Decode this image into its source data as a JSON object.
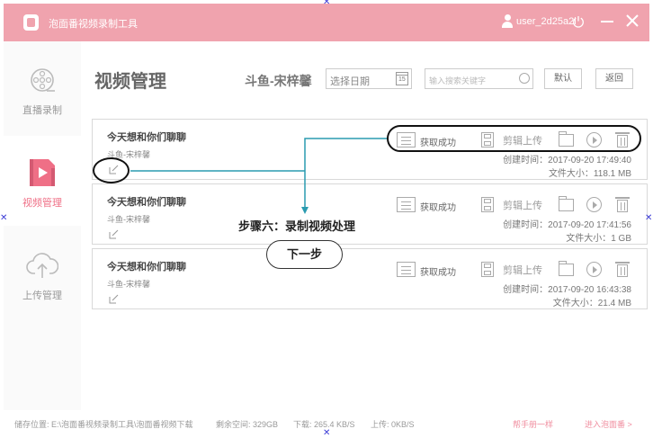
{
  "titlebar": {
    "app_title": "泡面番视频录制工具",
    "username": "user_2d25a2l"
  },
  "sidebar": {
    "items": [
      {
        "label": "直播录制",
        "icon": "film-reel-icon",
        "active": false
      },
      {
        "label": "视频管理",
        "icon": "video-file-icon",
        "active": true
      },
      {
        "label": "上传管理",
        "icon": "cloud-upload-icon",
        "active": false
      }
    ]
  },
  "header": {
    "title": "视频管理",
    "streamer": "斗鱼-宋梓馨",
    "date_placeholder": "选择日期",
    "calendar_day": "15",
    "search_placeholder": "输入搜索关键字",
    "default_button": "默认",
    "back_button": "返回"
  },
  "videos": [
    {
      "title": "今天想和你们聊聊",
      "streamer": "斗鱼-宋梓馨",
      "status": "获取成功",
      "upload": "剪辑上传",
      "created": "创建时间：2017-09-20 17:49:40",
      "size": "文件大小：118.1 MB"
    },
    {
      "title": "今天想和你们聊聊",
      "streamer": "斗鱼-宋梓馨",
      "status": "获取成功",
      "upload": "剪辑上传",
      "created": "创建时间：2017-09-20 17:41:56",
      "size": "文件大小：1 GB"
    },
    {
      "title": "今天想和你们聊聊",
      "streamer": "斗鱼-宋梓馨",
      "status": "获取成功",
      "upload": "剪辑上传",
      "created": "创建时间：2017-09-20 16:43:38",
      "size": "文件大小：21.4 MB"
    }
  ],
  "statusbar": {
    "save_path": "储存位置: E:\\泡面番视频录制工具\\泡面番视频下载",
    "free_space": "剩余空间: 329GB",
    "download": "下载: 265.4 KB/S",
    "upload": "上传: 0KB/S",
    "link1": "帮手册一样",
    "link2": "进入泡面番 >"
  },
  "tutorial": {
    "step_caption": "步骤六：录制视频处理",
    "next_button": "下一步"
  },
  "colors": {
    "accent": "#f0a3ae",
    "active_nav": "#ef6f86",
    "arrow": "#2a9bb0"
  }
}
